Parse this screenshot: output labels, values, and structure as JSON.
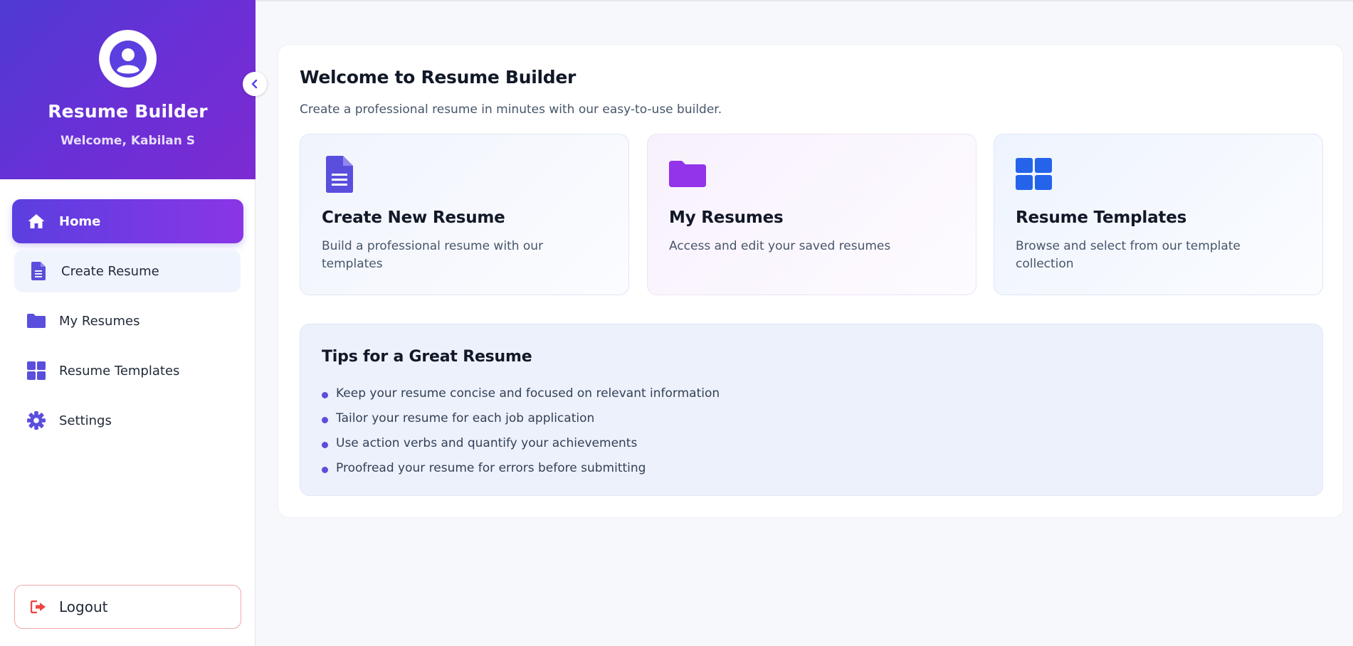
{
  "colors": {
    "accent": "#5b3fe0",
    "accent_purple": "#8a35e6",
    "icon_indigo": "#5a4fdc",
    "icon_purple": "#9333ea",
    "icon_blue": "#2563eb",
    "logout_red": "#ef4444"
  },
  "sidebar": {
    "title": "Resume Builder",
    "welcome": "Welcome, Kabilan S",
    "avatar_icon": "user-circle-icon",
    "collapse_icon": "chevron-left-icon",
    "items": [
      {
        "label": "Home",
        "icon": "home-icon",
        "active": true
      },
      {
        "label": "Create Resume",
        "icon": "document-icon",
        "hovered": true
      },
      {
        "label": "My Resumes",
        "icon": "folder-icon"
      },
      {
        "label": "Resume Templates",
        "icon": "grid-icon"
      },
      {
        "label": "Settings",
        "icon": "gear-icon"
      }
    ],
    "logout": {
      "label": "Logout",
      "icon": "sign-out-icon"
    }
  },
  "main": {
    "title": "Welcome to Resume Builder",
    "subtitle": "Create a professional resume in minutes with our easy-to-use builder.",
    "cards": [
      {
        "title": "Create New Resume",
        "description": "Build a professional resume with our templates",
        "icon": "document-icon"
      },
      {
        "title": "My Resumes",
        "description": "Access and edit your saved resumes",
        "icon": "folder-icon"
      },
      {
        "title": "Resume Templates",
        "description": "Browse and select from our template collection",
        "icon": "grid-icon"
      }
    ],
    "tips": {
      "title": "Tips for a Great Resume",
      "items": [
        "Keep your resume concise and focused on relevant information",
        "Tailor your resume for each job application",
        "Use action verbs and quantify your achievements",
        "Proofread your resume for errors before submitting"
      ]
    }
  }
}
